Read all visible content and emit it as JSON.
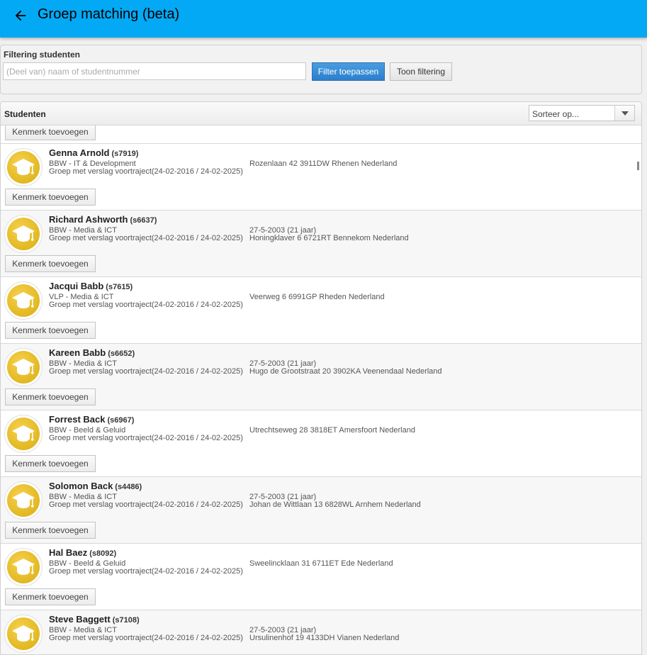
{
  "header": {
    "title": "Groep matching (beta)"
  },
  "filter": {
    "title": "Filtering studenten",
    "placeholder": "(Deel van) naam of studentnummer",
    "apply_label": "Filter toepassen",
    "show_label": "Toon filtering"
  },
  "students": {
    "title": "Studenten",
    "sort_placeholder": "Sorteer op...",
    "add_label": "Kenmerk toevoegen",
    "items": [
      {
        "name": "Genna Arnold",
        "id": "(s7919)",
        "program": "BBW - IT & Development",
        "group": "Groep met verslag voortraject(24-02-2016 / 24-02-2025)",
        "info1": "Rozenlaan 42  3911DW Rhenen Nederland",
        "info2": ""
      },
      {
        "name": "Richard Ashworth",
        "id": "(s6637)",
        "program": "BBW - Media & ICT",
        "group": "Groep met verslag voortraject(24-02-2016 / 24-02-2025)",
        "info1": "27-5-2003 (21 jaar)",
        "info2": "Honingklaver 6  6721RT Bennekom Nederland"
      },
      {
        "name": "Jacqui Babb",
        "id": "(s7615)",
        "program": "VLP - Media & ICT",
        "group": "Groep met verslag voortraject(24-02-2016 / 24-02-2025)",
        "info1": "Veerweg 6  6991GP Rheden Nederland",
        "info2": ""
      },
      {
        "name": "Kareen Babb",
        "id": "(s6652)",
        "program": "BBW - Media & ICT",
        "group": "Groep met verslag voortraject(24-02-2016 / 24-02-2025)",
        "info1": "27-5-2003 (21 jaar)",
        "info2": "Hugo de Grootstraat 20  3902KA Veenendaal Nederland"
      },
      {
        "name": "Forrest Back",
        "id": "(s6967)",
        "program": "BBW - Beeld & Geluid",
        "group": "Groep met verslag voortraject(24-02-2016 / 24-02-2025)",
        "info1": "Utrechtseweg 28  3818ET Amersfoort Nederland",
        "info2": ""
      },
      {
        "name": "Solomon Back",
        "id": "(s4486)",
        "program": "BBW - Media & ICT",
        "group": "Groep met verslag voortraject(24-02-2016 / 24-02-2025)",
        "info1": "27-5-2003 (21 jaar)",
        "info2": "Johan de Wittlaan 13  6828WL Arnhem Nederland"
      },
      {
        "name": "Hal Baez",
        "id": "(s8092)",
        "program": "BBW - Beeld & Geluid",
        "group": "Groep met verslag voortraject(24-02-2016 / 24-02-2025)",
        "info1": "Sweelincklaan 31  6711ET Ede Nederland",
        "info2": ""
      },
      {
        "name": "Steve Baggett",
        "id": "(s7108)",
        "program": "BBW - Media & ICT",
        "group": "Groep met verslag voortraject(24-02-2016 / 24-02-2025)",
        "info1": "27-5-2003 (21 jaar)",
        "info2": "Ursulinenhof 19  4133DH Vianen Nederland"
      }
    ]
  }
}
